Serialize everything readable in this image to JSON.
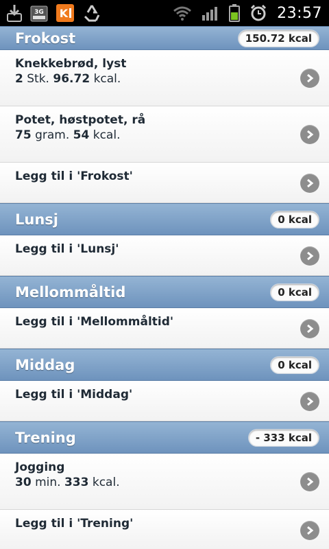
{
  "status_bar": {
    "time": "23:57",
    "icons": [
      "download-icon",
      "3g-icon",
      "app-k-icon",
      "recycle-icon",
      "wifi-icon",
      "signal-icon",
      "battery-icon",
      "alarm-icon"
    ]
  },
  "sections": [
    {
      "title": "Frokost",
      "total": "150.72 kcal",
      "items": [
        {
          "name": "Knekkebrød, lyst",
          "qty": "2",
          "unit": "Stk.",
          "kcal": "96.72",
          "kcal_unit": "kcal."
        },
        {
          "name": "Potet, høstpotet, rå",
          "qty": "75",
          "unit": "gram.",
          "kcal": "54",
          "kcal_unit": "kcal."
        }
      ],
      "add_label": "Legg til i 'Frokost'"
    },
    {
      "title": "Lunsj",
      "total": "0 kcal",
      "items": [],
      "add_label": "Legg til i 'Lunsj'"
    },
    {
      "title": "Mellommåltid",
      "total": "0 kcal",
      "items": [],
      "add_label": "Legg til i 'Mellommåltid'"
    },
    {
      "title": "Middag",
      "total": "0 kcal",
      "items": [],
      "add_label": "Legg til i 'Middag'"
    },
    {
      "title": "Trening",
      "total": "- 333 kcal",
      "items": [
        {
          "name": "Jogging",
          "qty": "30",
          "unit": "min.",
          "kcal": "333",
          "kcal_unit": "kcal."
        }
      ],
      "add_label": "Legg til i 'Trening'"
    }
  ],
  "colors": {
    "header_top": "#94b4d4",
    "header_bottom": "#6e93bd",
    "chevron": "#8d8d8d",
    "status_bar": "#000000",
    "battery": "#7cc520"
  }
}
